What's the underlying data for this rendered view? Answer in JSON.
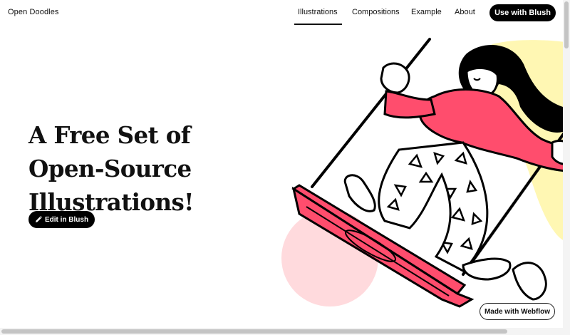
{
  "brand": "Open Doodles",
  "nav": {
    "items": [
      {
        "label": "Illustrations",
        "active": true
      },
      {
        "label": "Compositions",
        "active": false
      },
      {
        "label": "Example",
        "active": false
      },
      {
        "label": "About",
        "active": false
      }
    ],
    "cta_label": "Use with Blush"
  },
  "hero": {
    "title": "A Free Set of Open-Source Illustrations!",
    "edit_label": "Edit in Blush",
    "edit_icon": "pencil-icon"
  },
  "badge": "Made with Webflow",
  "colors": {
    "accent_pink": "#ff4d6d",
    "pale_pink": "#ffdadd",
    "pale_yellow": "#fff7b3",
    "ink": "#000000"
  }
}
